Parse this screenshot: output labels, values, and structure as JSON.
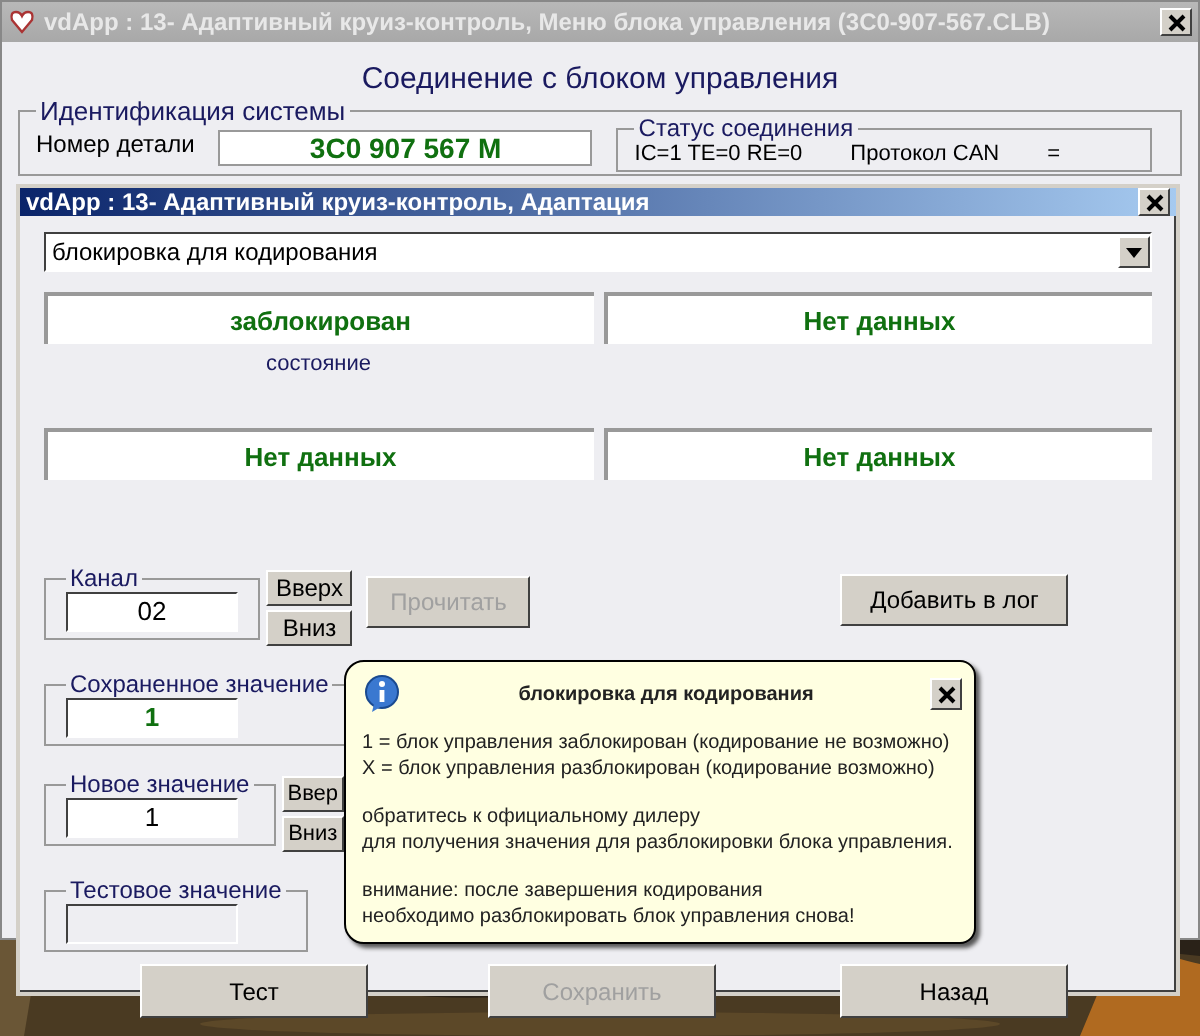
{
  "background_window": {
    "title": "vdApp : 13- Адаптивный круиз-контроль,  Меню блока управления (3C0-907-567.CLB)",
    "heading": "Соединение с блоком управления",
    "identification": {
      "legend": "Идентификация системы",
      "part_number_label": "Номер детали",
      "part_number": "3C0 907 567 M"
    },
    "connection_status": {
      "legend": "Статус соединения",
      "values": "IC=1  TE=0  RE=0",
      "protocol": "Протокол CAN",
      "column_3": "="
    }
  },
  "window": {
    "title": "vdApp : 13- Адаптивный круиз-контроль, Адаптация"
  },
  "function_select": {
    "value": "блокировка для кодирования"
  },
  "readouts": [
    {
      "value": "заблокирован",
      "caption": "состояние"
    },
    {
      "value": "Нет данных"
    },
    {
      "value": "Нет данных"
    },
    {
      "value": "Нет данных"
    }
  ],
  "channel": {
    "label": "Канал",
    "value": "02",
    "up": "Вверх",
    "down": "Вниз"
  },
  "read_button": {
    "label": "Прочитать",
    "disabled": true
  },
  "add_log_button": {
    "label": "Добавить в лог",
    "disabled": false
  },
  "saved_value": {
    "label": "Сохраненное значение",
    "value": "1"
  },
  "new_value": {
    "label": "Новое значение",
    "value": "1",
    "up": "Ввер",
    "down": "Вниз"
  },
  "test_value": {
    "label": "Тестовое значение"
  },
  "buttons": [
    {
      "label": "Тест",
      "disabled": false
    },
    {
      "label": "Сохранить",
      "disabled": true
    },
    {
      "label": "Назад",
      "disabled": false
    }
  ],
  "tooltip": {
    "title": "блокировка для кодирования",
    "paragraphs": [
      [
        "1 = блок управления заблокирован (кодирование не возможно)",
        "X = блок управления разблокирован (кодирование возможно)"
      ],
      [
        "обратитесь к официальному дилеру",
        "для получения значения для разблокировки блока управления."
      ],
      [
        "внимание: после завершения кодирования",
        "необходимо разблокировать блок управления снова!"
      ]
    ]
  }
}
